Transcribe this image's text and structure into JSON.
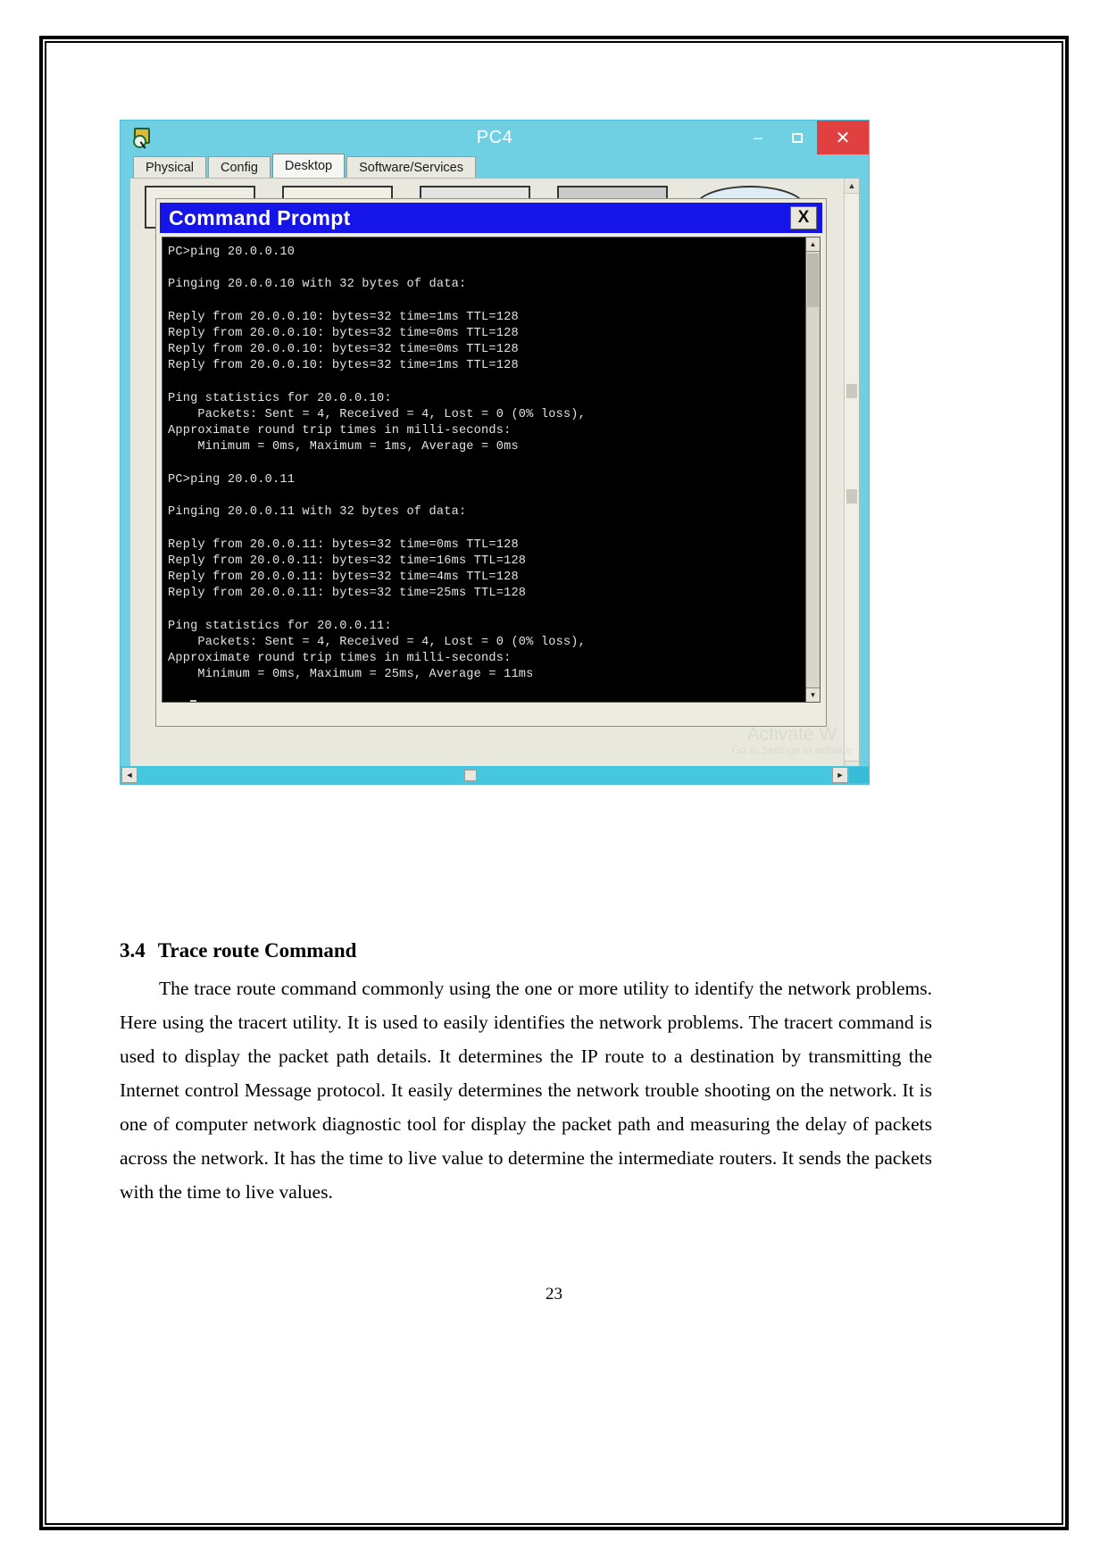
{
  "page": {
    "number": "23"
  },
  "figure": {
    "pt_window": {
      "title": "PC4",
      "app_icon": "magnifier-device-icon",
      "window_buttons": {
        "minimize": "–",
        "maximize": "□",
        "close": "✕"
      },
      "tabs": [
        {
          "label": "Physical",
          "active": false
        },
        {
          "label": "Config",
          "active": false
        },
        {
          "label": "Desktop",
          "active": true
        },
        {
          "label": "Software/Services",
          "active": false
        }
      ],
      "scroll": {
        "up_arrow": "▲",
        "down_arrow": "▼",
        "left_arrow": "◄",
        "right_arrow": "►"
      },
      "watermark": {
        "line1": "Activate W",
        "line2": "Go to Settings to activate"
      }
    },
    "cmd_window": {
      "title": "Command Prompt",
      "close_label": "X",
      "scroll": {
        "up_arrow": "▲",
        "down_arrow": "▼"
      },
      "console_text": "PC>ping 20.0.0.10\n\nPinging 20.0.0.10 with 32 bytes of data:\n\nReply from 20.0.0.10: bytes=32 time=1ms TTL=128\nReply from 20.0.0.10: bytes=32 time=0ms TTL=128\nReply from 20.0.0.10: bytes=32 time=0ms TTL=128\nReply from 20.0.0.10: bytes=32 time=1ms TTL=128\n\nPing statistics for 20.0.0.10:\n    Packets: Sent = 4, Received = 4, Lost = 0 (0% loss),\nApproximate round trip times in milli-seconds:\n    Minimum = 0ms, Maximum = 1ms, Average = 0ms\n\nPC>ping 20.0.0.11\n\nPinging 20.0.0.11 with 32 bytes of data:\n\nReply from 20.0.0.11: bytes=32 time=0ms TTL=128\nReply from 20.0.0.11: bytes=32 time=16ms TTL=128\nReply from 20.0.0.11: bytes=32 time=4ms TTL=128\nReply from 20.0.0.11: bytes=32 time=25ms TTL=128\n\nPing statistics for 20.0.0.11:\n    Packets: Sent = 4, Received = 4, Lost = 0 (0% loss),\nApproximate round trip times in milli-seconds:\n    Minimum = 0ms, Maximum = 25ms, Average = 11ms\n\nPC>"
    }
  },
  "document": {
    "section_number": "3.4",
    "section_title": "Trace route Command",
    "body": "The trace route command commonly using the one or more utility to identify the network problems. Here using the tracert utility. It is used to easily identifies the network problems. The tracert command is used to display the packet path details.  It determines the IP route to a destination by transmitting the Internet control Message protocol. It easily determines the network trouble shooting on the network. It is one of computer network diagnostic tool for display the packet path and measuring the delay of packets across the network. It has the time to live value to determine the intermediate routers. It sends the packets with the time to live values."
  }
}
